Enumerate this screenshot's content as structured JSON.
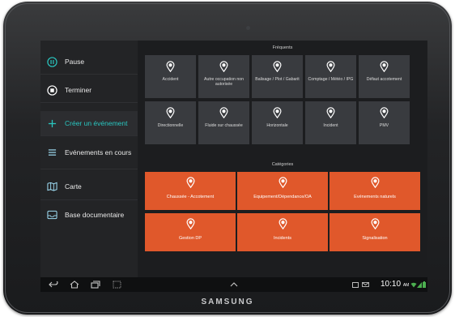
{
  "device": {
    "brand": "SAMSUNG"
  },
  "sidebar": {
    "items": [
      {
        "label": "Pause",
        "icon": "pause-icon",
        "accent": false
      },
      {
        "label": "Terminer",
        "icon": "stop-icon",
        "accent": false
      },
      {
        "label": "Créer un événement",
        "icon": "plus-icon",
        "accent": true
      },
      {
        "label": "Evénements en cours",
        "icon": "list-icon",
        "accent": false
      },
      {
        "label": "Carte",
        "icon": "map-icon",
        "accent": false
      },
      {
        "label": "Base documentaire",
        "icon": "inbox-icon",
        "accent": false
      }
    ]
  },
  "main": {
    "frequents_title": "Fréquents",
    "frequents": [
      {
        "label": "Accident"
      },
      {
        "label": "Autre occupation non autorisée"
      },
      {
        "label": "Balisage / Plot / Gabarit"
      },
      {
        "label": "Comptage / Météo / IPG"
      },
      {
        "label": "Défaut accotement"
      },
      {
        "label": "Directionnelle"
      },
      {
        "label": "Fluide sur chaussée"
      },
      {
        "label": "Horizontale"
      },
      {
        "label": "Incident"
      },
      {
        "label": "PMV"
      }
    ],
    "categories_title": "Catégories",
    "categories": [
      {
        "label": "Chaussée - Accotement"
      },
      {
        "label": "Equipement/Dépendance/OA"
      },
      {
        "label": "Evénements naturels"
      },
      {
        "label": "Gestion DP"
      },
      {
        "label": "Incidents"
      },
      {
        "label": "Signalisation"
      }
    ]
  },
  "statusbar": {
    "time": "10:10",
    "ampm": "AM"
  },
  "colors": {
    "accent": "#29c6c0",
    "category": "#e0582b",
    "tile": "#393b3f"
  }
}
